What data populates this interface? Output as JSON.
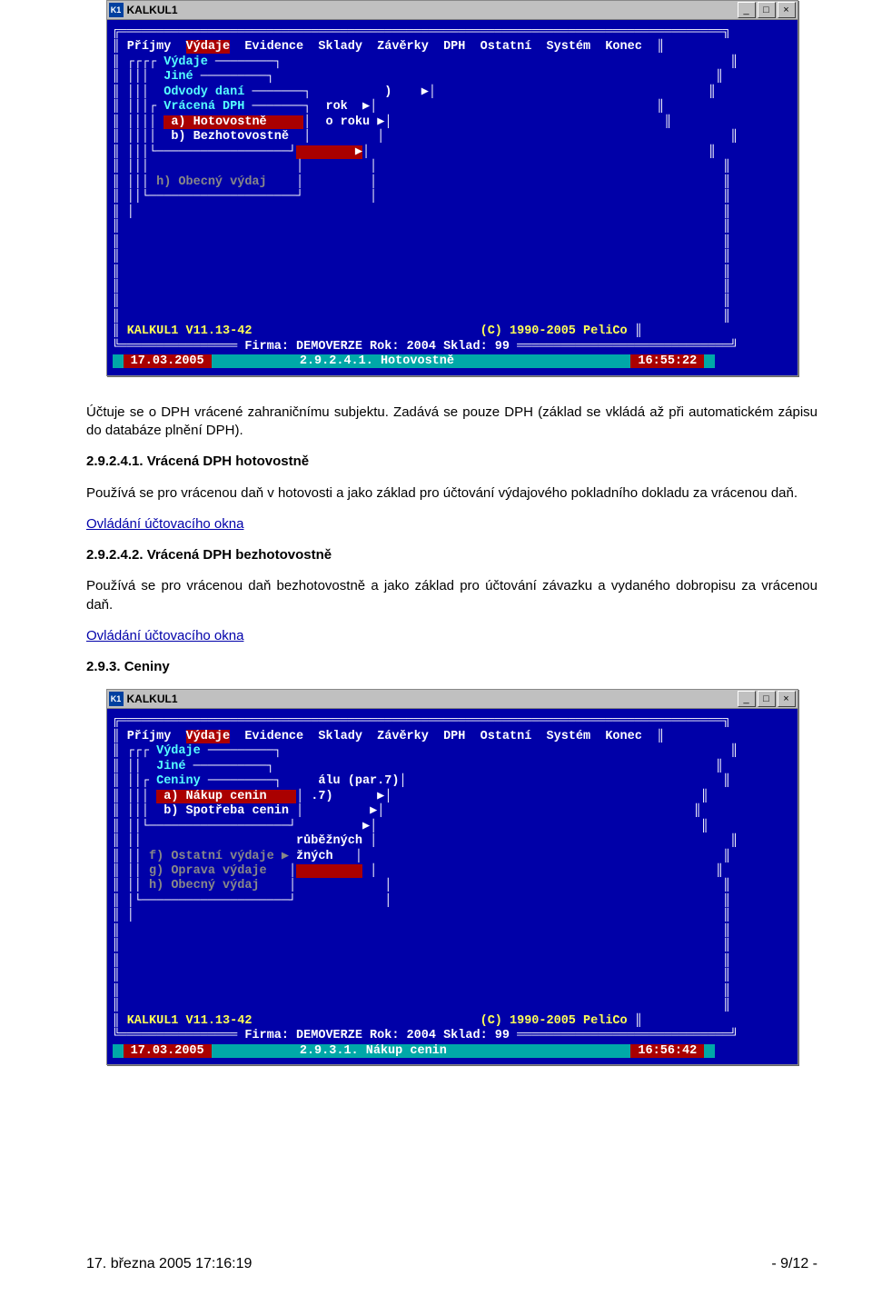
{
  "screenshot1": {
    "window_title": "KALKUL1",
    "icon_text": "K1",
    "winbtn_min": "_",
    "winbtn_max": "□",
    "winbtn_close": "×",
    "menubar": {
      "items": [
        "Příjmy",
        "Výdaje",
        "Evidence",
        "Sklady",
        "Závěrky",
        "DPH",
        "Ostatní",
        "Systém",
        "Konec"
      ],
      "selected_index": 1
    },
    "submenu_levels": [
      "Výdaje",
      "Jiné",
      "Odvody daní",
      "Vrácená DPH"
    ],
    "inner_items": [
      {
        "key": "a)",
        "label": "Hotovostně",
        "selected": true
      },
      {
        "key": "b)",
        "label": "Bezhotovostně",
        "selected": false
      }
    ],
    "side_fragments": [
      ")",
      "rok  ▶",
      "o roku ▶",
      "▶"
    ],
    "extra_item": "h) Obecný výdaj",
    "footer_left": "KALKUL1 V11.13-42",
    "footer_right": "(C) 1990-2005 PeliCo",
    "footer_mid": "Firma: DEMOVERZE Rok: 2004 Sklad: 99",
    "status_date": "17.03.2005",
    "status_mid": "2.9.2.4.1. Hotovostně",
    "status_time": "16:55:22"
  },
  "body_text": {
    "p1": "Účtuje se o DPH vrácené zahraničnímu subjektu. Zadává se pouze DPH (základ se vkládá až při automatickém zápisu do databáze plnění DPH).",
    "h1": "2.9.2.4.1. Vrácená DPH hotovostně",
    "p2": "Používá se pro vrácenou daň v hotovosti a jako základ pro účtování výdajového pokladního dokladu za vrácenou daň.",
    "link1": "Ovládání účtovacího okna",
    "h2": "2.9.2.4.2. Vrácená DPH bezhotovostně",
    "p3": "Používá se pro vrácenou daň bezhotovostně a jako základ pro účtování závazku a vydaného dobropisu za vrácenou daň.",
    "link2": "Ovládání účtovacího okna",
    "h3": "2.9.3. Ceniny"
  },
  "screenshot2": {
    "window_title": "KALKUL1",
    "icon_text": "K1",
    "winbtn_min": "_",
    "winbtn_max": "□",
    "winbtn_close": "×",
    "menubar": {
      "items": [
        "Příjmy",
        "Výdaje",
        "Evidence",
        "Sklady",
        "Závěrky",
        "DPH",
        "Ostatní",
        "Systém",
        "Konec"
      ],
      "selected_index": 1
    },
    "submenu_levels": [
      "Výdaje",
      "Jiné",
      "Ceniny"
    ],
    "inner_items": [
      {
        "key": "a)",
        "label": "Nákup cenin",
        "selected": true
      },
      {
        "key": "b)",
        "label": "Spotřeba cenin",
        "selected": false
      }
    ],
    "side_fragments": [
      "álu (par.7)",
      ".7)      ▶",
      "▶",
      "▶",
      "růběžných",
      "žných"
    ],
    "extra_items": [
      "f) Ostatní výdaje ▶",
      "g) Oprava výdaje",
      "h) Obecný výdaj"
    ],
    "footer_left": "KALKUL1 V11.13-42",
    "footer_right": "(C) 1990-2005 PeliCo",
    "footer_mid": "Firma: DEMOVERZE Rok: 2004 Sklad: 99",
    "status_date": "17.03.2005",
    "status_mid": "2.9.3.1. Nákup cenin",
    "status_time": "16:56:42"
  },
  "page_footer": {
    "left": "17. března 2005 17:16:19",
    "right": "- 9/12 -"
  }
}
